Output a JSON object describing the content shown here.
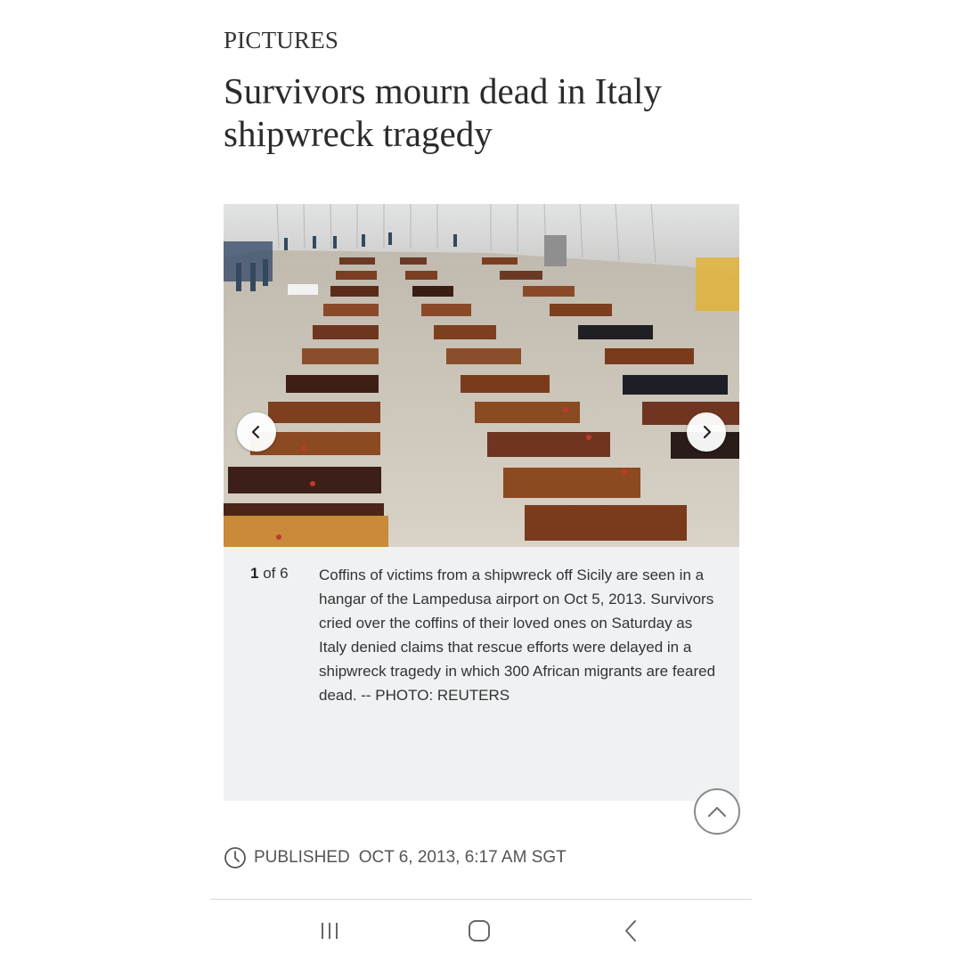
{
  "section": "PICTURES",
  "headline": "Survivors mourn dead in Italy shipwreck tragedy",
  "gallery": {
    "current": "1",
    "of_text": " of 6",
    "caption": "Coffins of victims from a shipwreck off Sicily are seen in a hangar of the Lampedusa airport on Oct 5, 2013. Survivors cried over the coffins of their loved ones on Saturday as Italy denied claims that rescue efforts were delayed in a shipwreck tragedy in which 300 African migrants are feared dead. -- PHOTO: REUTERS",
    "photo_alt": "Coffins of victims from a shipwreck off Sicily in a hangar of the Lampedusa airport"
  },
  "published": {
    "label": "PUBLISHED",
    "datetime": "OCT 6, 2013, 6:17 AM SGT"
  },
  "icons": {
    "prev": "chevron-left-icon",
    "next": "chevron-right-icon",
    "scroll_top": "chevron-up-icon",
    "clock": "clock-icon",
    "recents": "recents-icon",
    "home": "home-icon",
    "back": "back-icon"
  },
  "colors": {
    "caption_bg": "#eff1f2",
    "text": "#333333"
  }
}
